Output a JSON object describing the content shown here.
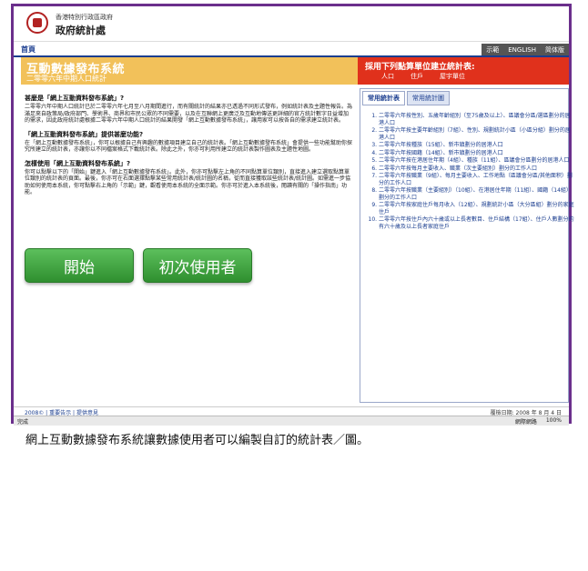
{
  "gov": {
    "name": "香港特別行政區政府",
    "dept": "政府統計處"
  },
  "nav": {
    "home": "首頁",
    "right": [
      "示範",
      "ENGLISH",
      "简体版"
    ]
  },
  "title": {
    "main": "互動數據發布系統",
    "sub": "二零零六年中期人口統計"
  },
  "title_right": {
    "line1": "採用下列點算單位建立統計表:",
    "units": [
      "人口",
      "住戶",
      "屋宇單位"
    ]
  },
  "faq": [
    {
      "q": "甚麼是「網上互動資料發布系統」?",
      "a": "二零零六年中期人口統計已於二零零六年七月至八月期間進行，而有關統計的結果亦已透過不同形式發布，例如統計表及主題性報告。為滿足來自政策局/政府部門、學術界、商界和市民公眾的不同需要，以及在互聯網上更廣泛及互動地傳送更詳細的官方統計數字日益增加的需求，因此政府統計處根據二零零六年中期人口統計的結果開發「網上互動數據發布系統」，讓用家可以按各自的需求建立統計表。"
    },
    {
      "q": "「網上互動資料發布系統」提供甚麼功能?",
      "a": "在「網上互動數據發布系統」，你可以根據自己有興趣的數據項目建立自己的統計表。「網上互動數據發布系統」會提供一些功能幫助你探究所建立的統計表，亦讓你以不同檔案格式下載統計表。除此之外，你亦可利用所建立的統計表製作圖表及主題性地圖。"
    },
    {
      "q": "怎樣使用「網上互動資料發布系統」?",
      "a": "你可以點擊以下的「開始」鍵進入「網上互動數據發布系統」。此外，你亦可點擊左上角的不同點算單位類別，直接進入建立選取點算單位類別的統計表的頁面。最後，你亦可在右面選擇點擊某些常用統計表/統計圖的名稱，從而直接獲取該些統計表/統計圖。如需進一步協助如何使用本系統，你可點擊右上角的「示範」鍵，觀看使用本系統的全面示範。你亦可於進入本系統後，閱讀有關的「操作指南」功能。"
    }
  ],
  "buttons": {
    "start": "開始",
    "first_time": "初次使用者"
  },
  "tabs": [
    "常用統計表",
    "常用統計圖"
  ],
  "table_list": [
    "二零零六年按性別、五歲年齡組別（至75歲及以上）、區議會分區/選區劃分的居港人口",
    "二零零六年按主要年齡組別（7組）、性別、規劃統計小區（小區分組）劃分的居港人口",
    "二零零六年按種族（15組）、新市鎮劃分的居港人口",
    "二零零六年按國籍（14組）、新市鎮劃分的居港人口",
    "二零零六年按在港居住年期（4組）、種族（11組）、區議會分區劃分的居港人口",
    "二零零六年按每月主要收入、職業（次主要組別）劃分的工作人口",
    "二零零六年按職業（9組）、每月主要收入、工作地點（區議會分區/其他面积）劃分的工作人口",
    "二零零六年按職業（主要組別）（10組）、在港居住年期（11組）、國籍（14組）劃分的工作人口",
    "二零零六年按家庭住戶每月收入（12組）、規劃統計小區（大分區組）劃分的家庭住戶",
    "二零零六年按住戶內六十歲或以上長者數目、住戶結構（17組）、住戶人數劃分的有六十歲及以上長者家庭住戶"
  ],
  "footer": {
    "left": "2008© | 重要告示 | 提供意見",
    "right": "覆檢日期: 2008 年 8 月 4 日"
  },
  "statusbar": {
    "left": "完成",
    "zone": "網際網路",
    "zoom": "100%"
  },
  "caption": "網上互動數據發布系統讓數據使用者可以編製自訂的統計表／圖。"
}
